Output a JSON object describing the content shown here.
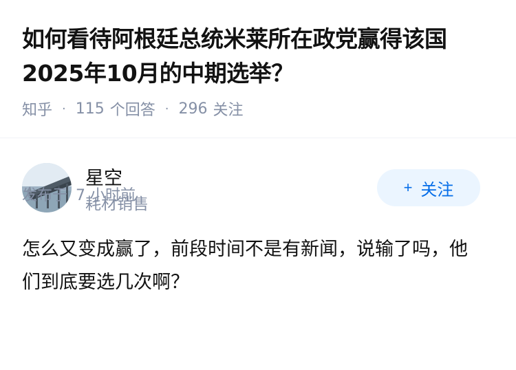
{
  "question": {
    "title": "如何看待阿根廷总统米莱所在政党赢得该国2025年10月的中期选举？",
    "source": "知乎",
    "answers_count": "115",
    "answers_label": "个回答",
    "followers_count": "296",
    "followers_label": "关注"
  },
  "answer": {
    "author_name": "星空",
    "author_tag": "耗材销售",
    "follow_label": "关注",
    "follow_icon": "plus-icon",
    "content": "怎么又变成赢了，前段时间不是有新闻，说输了吗，他们到底要选几次啊？",
    "time_prefix": "发布于",
    "time_value": "7 小时前"
  },
  "colors": {
    "title": "#121212",
    "meta": "#8590a6",
    "accent": "#056de8",
    "button_bg": "#ebf5ff"
  }
}
